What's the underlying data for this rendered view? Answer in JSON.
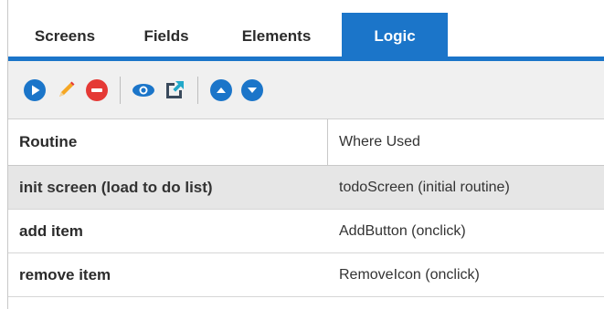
{
  "tabs": [
    {
      "label": "Screens",
      "active": false
    },
    {
      "label": "Fields",
      "active": false
    },
    {
      "label": "Elements",
      "active": false
    },
    {
      "label": "Logic",
      "active": true
    }
  ],
  "toolbar": {
    "icons": [
      "run-icon",
      "edit-icon",
      "remove-icon",
      "view-icon",
      "open-external-icon",
      "move-up-icon",
      "move-down-icon"
    ]
  },
  "colors": {
    "accent": "#1b75c9",
    "edit": "#f5a623",
    "remove": "#e53935",
    "toolbar_bg": "#f0f0f0",
    "selected_row": "#e6e6e6"
  },
  "table": {
    "columns": [
      "Routine",
      "Where Used"
    ],
    "rows": [
      {
        "routine": "init screen (load to do list)",
        "where_used": "todoScreen (initial routine)",
        "selected": true
      },
      {
        "routine": "add item",
        "where_used": "AddButton (onclick)",
        "selected": false
      },
      {
        "routine": "remove item",
        "where_used": "RemoveIcon (onclick)",
        "selected": false
      }
    ]
  }
}
